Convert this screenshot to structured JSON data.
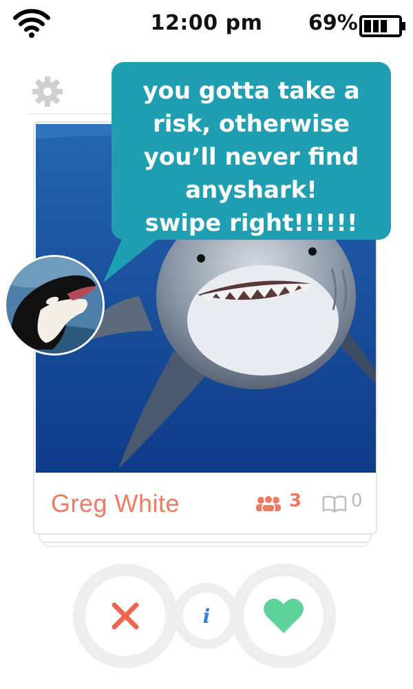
{
  "status_bar": {
    "time": "12:00 pm",
    "battery_percent": "69%",
    "battery_level": 0.69,
    "wifi_icon": "wifi-icon",
    "battery_icon": "battery-icon"
  },
  "nav": {
    "settings_icon": "gear-icon"
  },
  "bubble": {
    "lines": [
      "you gotta take a",
      "risk, otherwise",
      "you’ll never find",
      "anyshark!",
      "swipe right!!!!!!"
    ],
    "color": "#1f9fb1"
  },
  "profile": {
    "name": "Greg White",
    "mutual_friends": "3",
    "shared_interests": "0",
    "name_color": "#f07a63",
    "photo": "shark-photo",
    "avatar": "orca-avatar"
  },
  "controls": {
    "nope_icon": "x-icon",
    "info_label": "i",
    "like_icon": "heart-icon",
    "nope_color": "#f0634f",
    "info_color": "#2f7fde",
    "like_color": "#5dd39a"
  }
}
